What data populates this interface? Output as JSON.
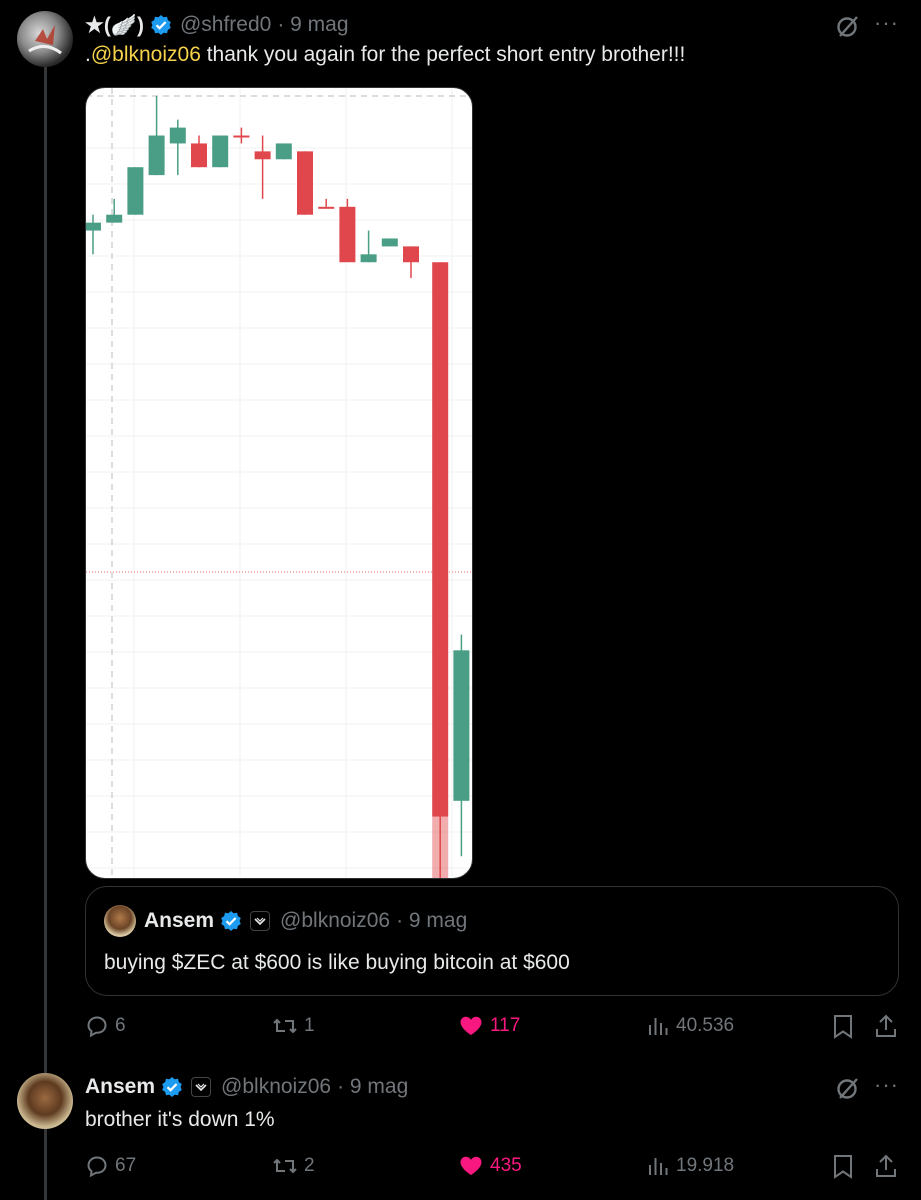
{
  "post": {
    "name": "★(🪽)",
    "handle": "@shfred0",
    "time": "· 9 mag",
    "mention": "@blknoiz06",
    "text_prefix": ".",
    "text": " thank you again for the perfect short entry brother!!!",
    "quote": {
      "name": "Ansem",
      "handle": "@blknoiz06",
      "time": "· 9 mag",
      "text": "buying $ZEC at $600 is like buying bitcoin at $600"
    },
    "replies": "6",
    "reposts": "1",
    "likes": "117",
    "views": "40.536"
  },
  "reply": {
    "name": "Ansem",
    "handle": "@blknoiz06",
    "time": "· 9 mag",
    "text": "brother it's down 1%",
    "replies": "67",
    "reposts": "2",
    "likes": "435",
    "views": "19.918"
  },
  "colors": {
    "up": "#4a9e85",
    "down": "#e0474c",
    "like": "#f91880",
    "mention": "#f6d24a",
    "muted": "#71767b"
  },
  "chart_data": {
    "type": "candlestick",
    "note": "candles (open, high, low, close) shown on white chart without axis labels; values in relative price units (0 = top, 100 = bottom)",
    "candles": [
      {
        "o": 18,
        "h": 16,
        "l": 21,
        "c": 17
      },
      {
        "o": 17,
        "h": 14,
        "l": 17,
        "c": 16
      },
      {
        "o": 16,
        "h": 10,
        "l": 16,
        "c": 10
      },
      {
        "o": 11,
        "h": 1,
        "l": 11,
        "c": 6
      },
      {
        "o": 7,
        "h": 4,
        "l": 11,
        "c": 5
      },
      {
        "o": 7,
        "h": 6,
        "l": 10,
        "c": 10
      },
      {
        "o": 10,
        "h": 6,
        "l": 10,
        "c": 6
      },
      {
        "o": 6,
        "h": 5,
        "l": 7,
        "c": 6
      },
      {
        "o": 8,
        "h": 6,
        "l": 14,
        "c": 9
      },
      {
        "o": 9,
        "h": 7,
        "l": 9,
        "c": 7
      },
      {
        "o": 8,
        "h": 8,
        "l": 16,
        "c": 16
      },
      {
        "o": 15,
        "h": 14,
        "l": 15,
        "c": 15
      },
      {
        "o": 15,
        "h": 14,
        "l": 21,
        "c": 22
      },
      {
        "o": 22,
        "h": 18,
        "l": 22,
        "c": 21
      },
      {
        "o": 20,
        "h": 19,
        "l": 20,
        "c": 19
      },
      {
        "o": 20,
        "h": 20,
        "l": 24,
        "c": 22
      },
      {
        "o": 22,
        "h": 22,
        "l": 100,
        "c": 92
      },
      {
        "o": 90,
        "h": 69,
        "l": 97,
        "c": 71
      },
      {
        "o": 70,
        "h": 70,
        "l": 70,
        "c": 70
      }
    ]
  }
}
